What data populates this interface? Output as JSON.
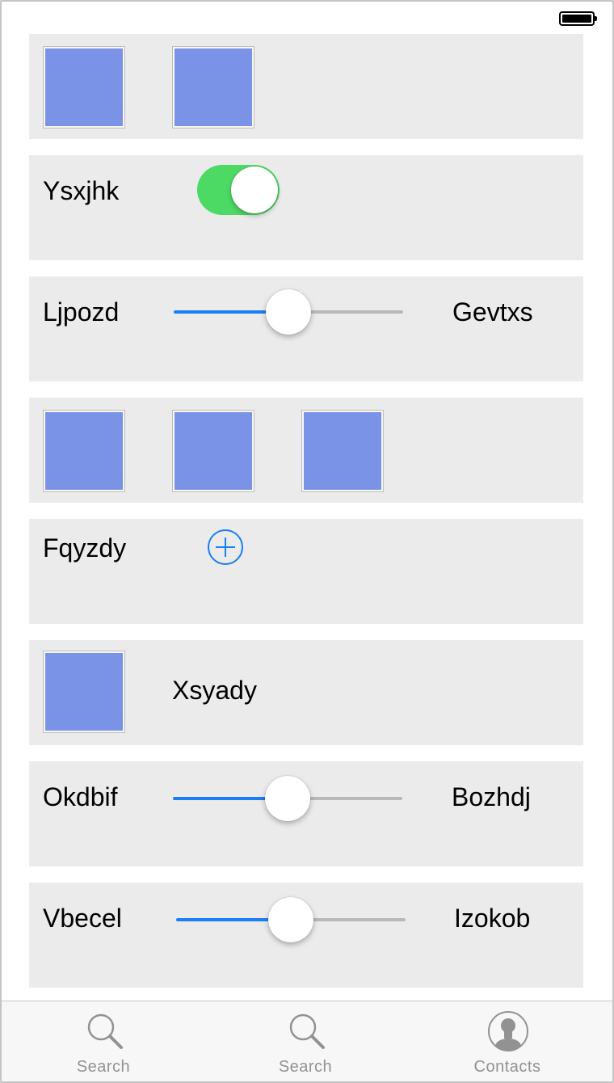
{
  "rows": {
    "toggle": {
      "label": "Ysxjhk",
      "on": true
    },
    "slider1": {
      "label": "Ljpozd",
      "end_label": "Gevtxs",
      "value": 0.5
    },
    "add": {
      "label": "Fqyzdy"
    },
    "image_text": {
      "label": "Xsyady"
    },
    "slider2": {
      "label": "Okdbif",
      "end_label": "Bozhdj",
      "value": 0.5
    },
    "slider3": {
      "label": "Vbecel",
      "end_label": "Izokob",
      "value": 0.5
    }
  },
  "tabs": [
    {
      "label": "Search",
      "icon": "search-icon"
    },
    {
      "label": "Search",
      "icon": "search-icon"
    },
    {
      "label": "Contacts",
      "icon": "contacts-icon"
    }
  ],
  "colors": {
    "accent": "#1a7ef5",
    "switch_on": "#4cd964",
    "thumbnail": "#7b93e6",
    "card_bg": "#ebebeb"
  }
}
